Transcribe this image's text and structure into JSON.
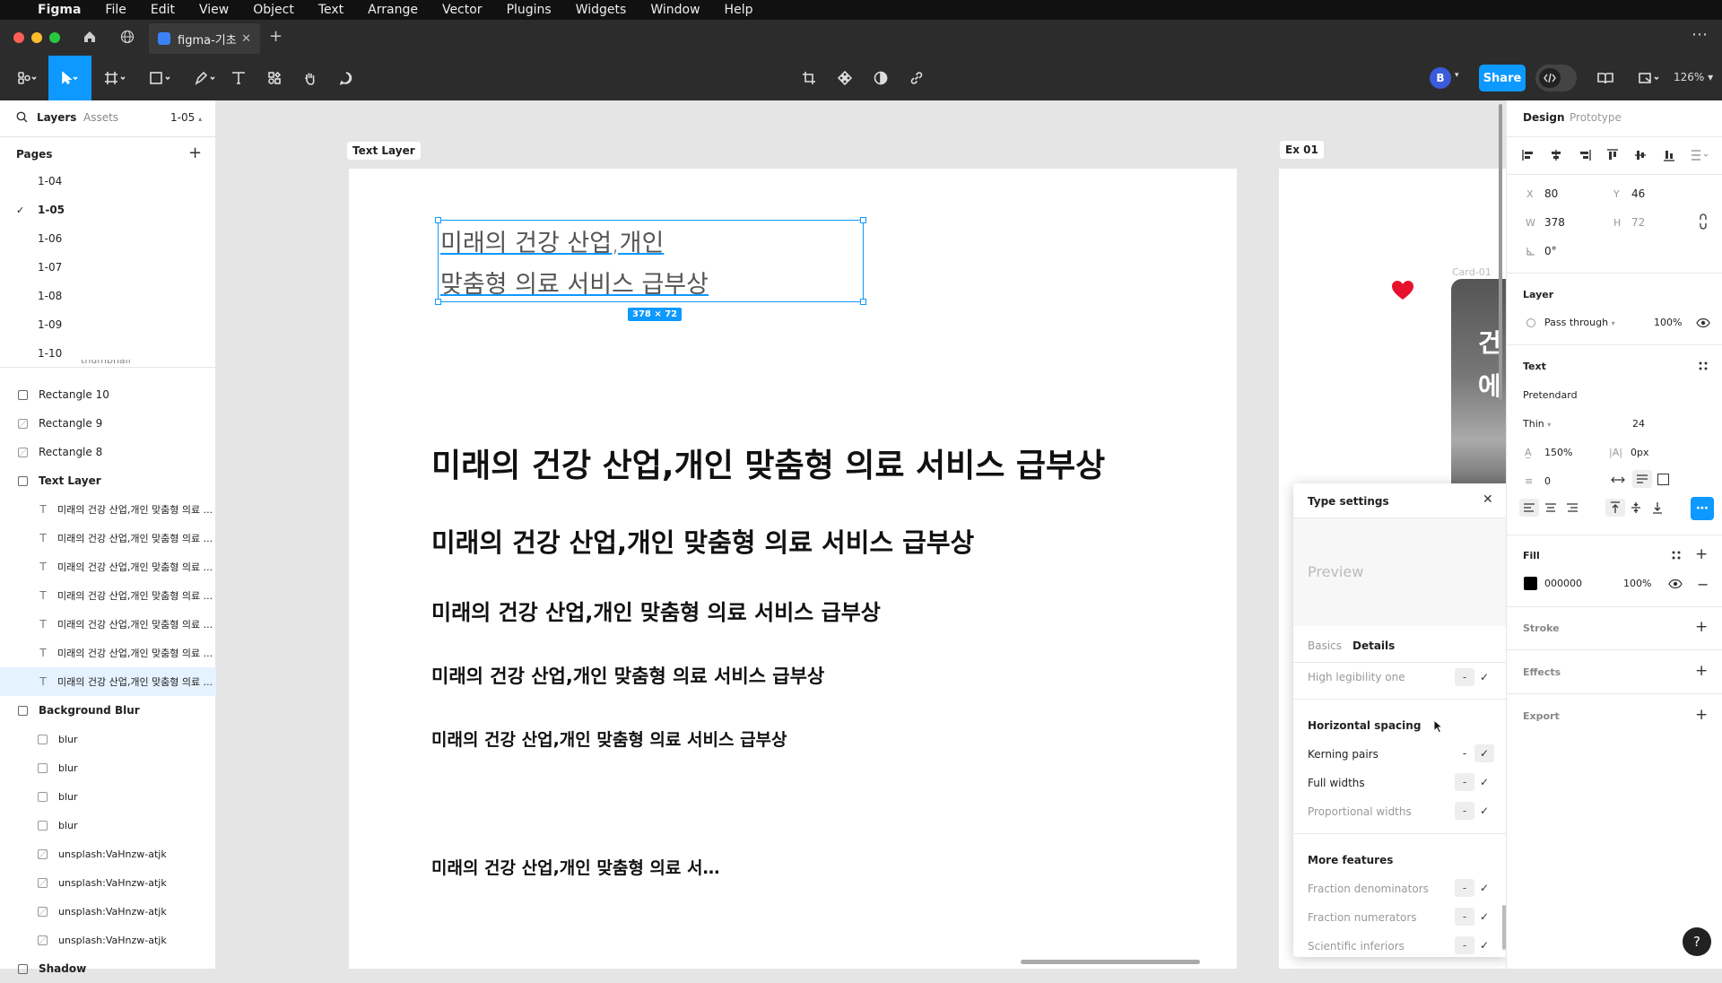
{
  "menubar": {
    "app": "Figma",
    "items": [
      "File",
      "Edit",
      "View",
      "Object",
      "Text",
      "Arrange",
      "Vector",
      "Plugins",
      "Widgets",
      "Window",
      "Help"
    ]
  },
  "tab": {
    "title": "figma-기초"
  },
  "toolbar": {
    "share_label": "Share",
    "zoom": "126%",
    "avatar_initial": "B"
  },
  "left_panel": {
    "tabs": {
      "layers": "Layers",
      "assets": "Assets",
      "page_select": "1-05"
    },
    "pages_header": "Pages",
    "pages": [
      {
        "label": "1-04",
        "current": false
      },
      {
        "label": "1-05",
        "current": true
      },
      {
        "label": "1-06",
        "current": false
      },
      {
        "label": "1-07",
        "current": false
      },
      {
        "label": "1-08",
        "current": false
      },
      {
        "label": "1-09",
        "current": false
      },
      {
        "label": "1-10",
        "current": false
      }
    ],
    "partial_layer": "thumbnail",
    "layers": [
      {
        "label": "Rectangle 10",
        "type": "frame",
        "indent": 0
      },
      {
        "label": "Rectangle 9",
        "type": "image",
        "indent": 0
      },
      {
        "label": "Rectangle 8",
        "type": "image",
        "indent": 0
      },
      {
        "label": "Text Layer",
        "type": "frame",
        "indent": 0
      },
      {
        "label": "미래의 건강 산업,개인 맞춤형 의료 ...",
        "type": "text",
        "indent": 1
      },
      {
        "label": "미래의 건강 산업,개인 맞춤형 의료 ...",
        "type": "text",
        "indent": 1
      },
      {
        "label": "미래의 건강 산업,개인 맞춤형 의료 ...",
        "type": "text",
        "indent": 1
      },
      {
        "label": "미래의 건강 산업,개인 맞춤형 의료 ...",
        "type": "text",
        "indent": 1
      },
      {
        "label": "미래의 건강 산업,개인 맞춤형 의료 ...",
        "type": "text",
        "indent": 1
      },
      {
        "label": "미래의 건강 산업,개인 맞춤형 의료 ...",
        "type": "text",
        "indent": 1
      },
      {
        "label": "미래의 건강 산업,개인 맞춤형 의료 ...",
        "type": "text",
        "indent": 1,
        "selected": true
      },
      {
        "label": "Background Blur",
        "type": "frame",
        "indent": 0
      },
      {
        "label": "blur",
        "type": "rect",
        "indent": 1
      },
      {
        "label": "blur",
        "type": "rect",
        "indent": 1
      },
      {
        "label": "blur",
        "type": "rect",
        "indent": 1
      },
      {
        "label": "blur",
        "type": "rect",
        "indent": 1
      },
      {
        "label": "unsplash:VaHnzw-atjk",
        "type": "image",
        "indent": 1
      },
      {
        "label": "unsplash:VaHnzw-atjk",
        "type": "image",
        "indent": 1
      },
      {
        "label": "unsplash:VaHnzw-atjk",
        "type": "image",
        "indent": 1
      },
      {
        "label": "unsplash:VaHnzw-atjk",
        "type": "image",
        "indent": 1
      },
      {
        "label": "Shadow",
        "type": "frame",
        "indent": 0
      }
    ]
  },
  "canvas": {
    "frame_label": "Text Layer",
    "frame2_label": "Ex 01",
    "card_label": "Card-01",
    "card_text_1": "건",
    "card_text_2": "에",
    "selected_text_line1": "미래의 건강 산업,개인",
    "selected_text_line2": "맞춤형 의료 서비스 급부상",
    "size_badge": "378 × 72",
    "headings": [
      "미래의 건강 산업,개인 맞춤형 의료 서비스 급부상",
      "미래의 건강 산업,개인 맞춤형 의료 서비스 급부상",
      "미래의 건강 산업,개인 맞춤형 의료 서비스 급부상",
      "미래의 건강 산업,개인 맞춤형 의료 서비스 급부상",
      "미래의 건강 산업,개인 맞춤형 의료 서비스 급부상",
      "미래의 건강 산업,개인 맞춤형 의료 서…"
    ]
  },
  "type_settings": {
    "title": "Type settings",
    "preview": "Preview",
    "tab_basics": "Basics",
    "tab_details": "Details",
    "high_legibility": "High legibility one",
    "horizontal_spacing": "Horizontal spacing",
    "kerning_pairs": "Kerning pairs",
    "full_widths": "Full widths",
    "proportional_widths": "Proportional widths",
    "more_features": "More features",
    "fraction_denominators": "Fraction denominators",
    "fraction_numerators": "Fraction numerators",
    "scientific_inferiors": "Scientific inferiors",
    "dash": "-",
    "check": "✓"
  },
  "right_panel": {
    "tab_design": "Design",
    "tab_prototype": "Prototype",
    "x_label": "X",
    "x_value": "80",
    "y_label": "Y",
    "y_value": "46",
    "w_label": "W",
    "w_value": "378",
    "h_label": "H",
    "h_value": "72",
    "rotation": "0°",
    "layer_header": "Layer",
    "blend_mode": "Pass through",
    "layer_opacity": "100%",
    "text_header": "Text",
    "font_family": "Pretendard",
    "font_weight": "Thin",
    "font_size": "24",
    "line_height": "150%",
    "letter_spacing": "0px",
    "paragraph_spacing": "0",
    "fill_header": "Fill",
    "fill_hex": "000000",
    "fill_opacity": "100%",
    "fill_color": "#000000",
    "stroke_header": "Stroke",
    "effects_header": "Effects",
    "export_header": "Export"
  },
  "colors": {
    "accent": "#0d99ff",
    "heart": "#e8112d"
  }
}
